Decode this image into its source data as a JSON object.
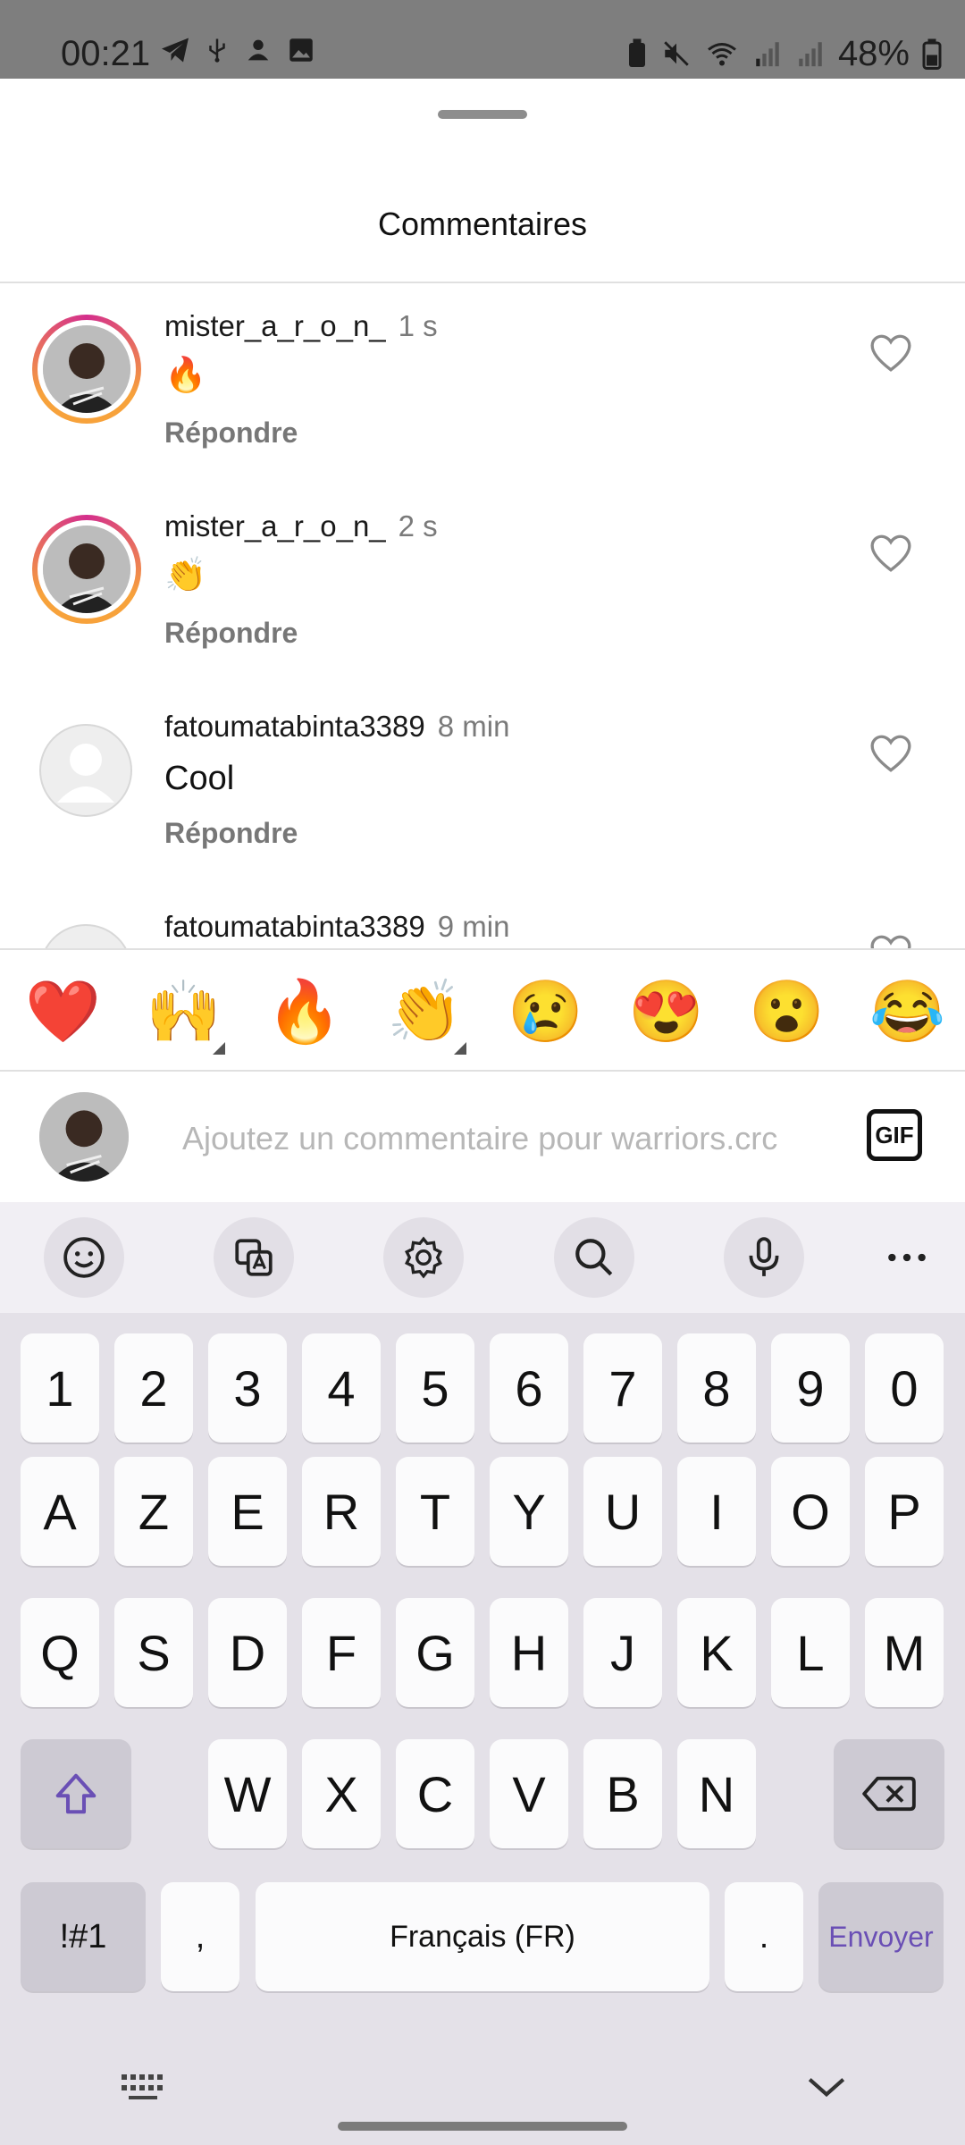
{
  "status_bar": {
    "time": "00:21",
    "battery": "48%"
  },
  "sheet": {
    "title": "Commentaires"
  },
  "comments": [
    {
      "username": "mister_a_r_o_n_",
      "time": "1 s",
      "text": "🔥",
      "reply_label": "Répondre",
      "story_ring": true
    },
    {
      "username": "mister_a_r_o_n_",
      "time": "2 s",
      "text": "👏",
      "reply_label": "Répondre",
      "story_ring": true
    },
    {
      "username": "fatoumatabinta3389",
      "time": "8 min",
      "text": "Cool",
      "reply_label": "Répondre",
      "story_ring": false
    },
    {
      "username": "fatoumatabinta3389",
      "time": "9 min",
      "text": "",
      "reply_label": "",
      "story_ring": false
    }
  ],
  "quick_reactions": [
    "❤️",
    "🙌",
    "🔥",
    "👏",
    "😢",
    "😍",
    "😮",
    "😂"
  ],
  "comment_input": {
    "placeholder": "Ajoutez un commentaire pour warriors.crc",
    "gif_label": "GIF"
  },
  "keyboard": {
    "toolbar": [
      "emoji-icon",
      "translate-icon",
      "settings-icon",
      "search-icon",
      "microphone-icon",
      "more-icon"
    ],
    "row_numbers": [
      "1",
      "2",
      "3",
      "4",
      "5",
      "6",
      "7",
      "8",
      "9",
      "0"
    ],
    "row1": [
      "A",
      "Z",
      "E",
      "R",
      "T",
      "Y",
      "U",
      "I",
      "O",
      "P"
    ],
    "row2": [
      "Q",
      "S",
      "D",
      "F",
      "G",
      "H",
      "J",
      "K",
      "L",
      "M"
    ],
    "row3": [
      "W",
      "X",
      "C",
      "V",
      "B",
      "N"
    ],
    "symbols_label": "!#1",
    "comma_label": ",",
    "space_label": "Français (FR)",
    "period_label": ".",
    "send_label": "Envoyer",
    "accent_color": "#6a4fb5"
  }
}
